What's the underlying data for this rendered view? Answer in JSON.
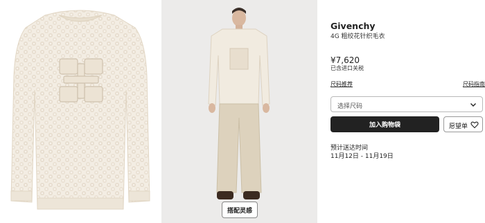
{
  "product": {
    "brand": "Givenchy",
    "name": "4G 粗绞花针织毛衣",
    "price": "¥7,620",
    "tax_note": "已含进口关税"
  },
  "size": {
    "recommend_label": "尺码推荐",
    "guide_label": "尺码指南",
    "select_placeholder": "选择尺码"
  },
  "actions": {
    "add_to_bag": "加入购物袋",
    "wishlist": "愿望单",
    "inspiration": "搭配灵感"
  },
  "delivery": {
    "title": "预计送达时间",
    "dates": "11月12日 - 11月19日"
  },
  "icons": {
    "select_chevron": "chevron-down-icon",
    "wishlist": "heart-icon"
  },
  "colors": {
    "primary_button": "#222222",
    "sweater": "#f2ece2",
    "trousers": "#ddd2bd",
    "model_background": "#ecebea"
  }
}
